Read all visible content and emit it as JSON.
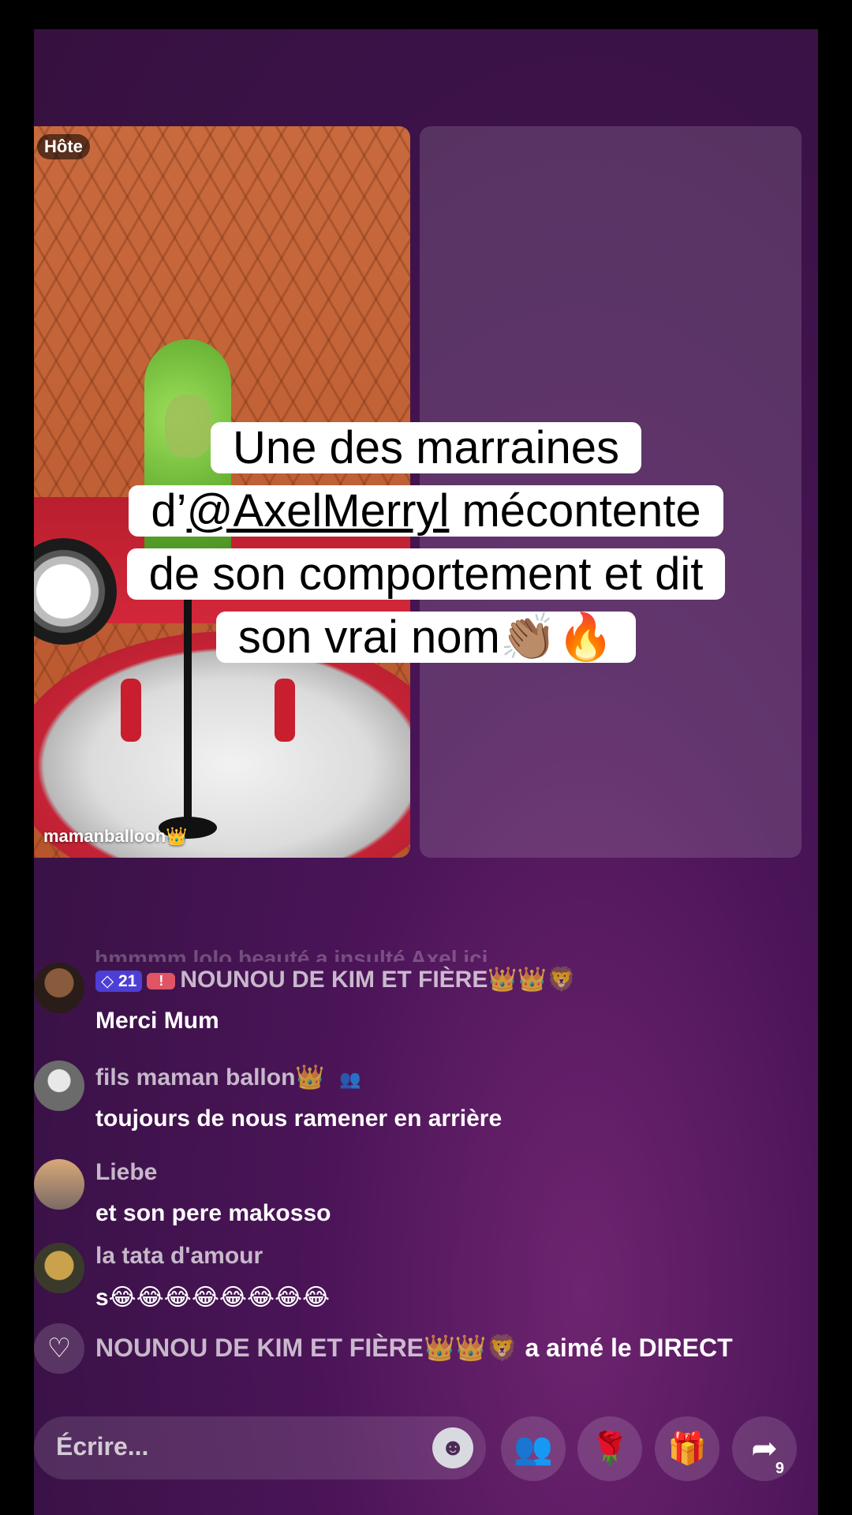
{
  "host_panel": {
    "badge": "Hôte",
    "host_name": "mamanballoon👑"
  },
  "caption": {
    "line1": "Une des marraines",
    "line2_prefix": "d’",
    "line2_handle": "@AxelMerryl",
    "line2_suffix": " mécontente",
    "line3": "de son comportement et dit",
    "line4": "son vrai nom👏🏽🔥"
  },
  "chat": {
    "faded_line": "hmmmm lolo beauté a insulté Axel ici.",
    "messages": [
      {
        "level": "21",
        "heart_badge": "!",
        "user": "NOUNOU DE KIM ET FIÈRE👑👑🦁",
        "text": "Merci Mum"
      },
      {
        "user": "fils maman ballon👑",
        "user_extra": "👥",
        "text": "toujours de nous ramener en arrière"
      },
      {
        "user": "Liebe",
        "text": "et son pere makosso"
      },
      {
        "user": "la tata d'amour",
        "text": "s😂😂😂😂😂😂😂😂"
      }
    ],
    "like_event": {
      "user": "NOUNOU DE KIM ET FIÈRE👑👑🦁",
      "action": " a aimé le DIRECT"
    }
  },
  "bottom_bar": {
    "input_placeholder": "Écrire...",
    "share_count": "9"
  },
  "icons": {
    "heart": "heart-icon",
    "smiley": "smiley-icon",
    "multi_guest": "multi-guest-icon",
    "rose": "rose-icon",
    "gift": "gift-icon",
    "share": "share-icon"
  }
}
